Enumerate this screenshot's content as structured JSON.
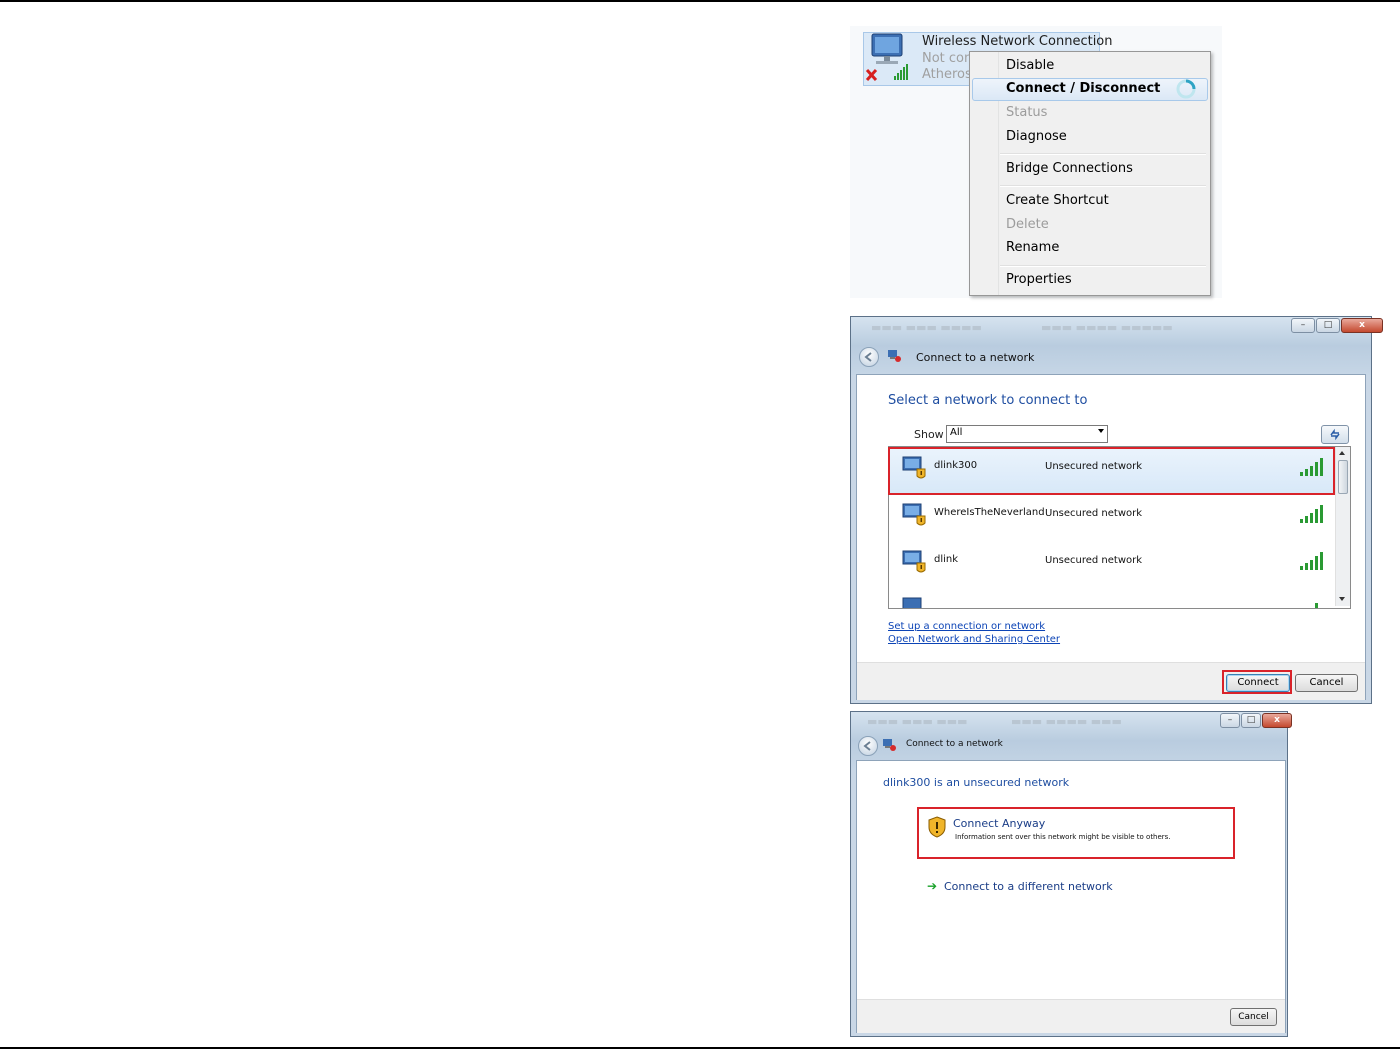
{
  "connection": {
    "name": "Wireless Network Connection",
    "status": "Not con",
    "adapter": "Atheros"
  },
  "context_menu": {
    "items": [
      {
        "label": "Disable",
        "enabled": true,
        "bold": false
      },
      {
        "label": "Connect / Disconnect",
        "enabled": true,
        "bold": true,
        "highlighted": true
      },
      {
        "label": "Status",
        "enabled": false,
        "bold": false
      },
      {
        "label": "Diagnose",
        "enabled": true,
        "bold": false
      },
      {
        "label": "Bridge Connections",
        "enabled": true,
        "bold": false
      },
      {
        "label": "Create Shortcut",
        "enabled": true,
        "bold": false
      },
      {
        "label": "Delete",
        "enabled": false,
        "bold": false
      },
      {
        "label": "Rename",
        "enabled": true,
        "bold": false
      },
      {
        "label": "Properties",
        "enabled": true,
        "bold": false
      }
    ]
  },
  "connect_window": {
    "title": "Connect to a network",
    "heading": "Select a network to connect to",
    "show_label": "Show",
    "show_value": "All",
    "networks": [
      {
        "ssid": "dlink300",
        "security": "Unsecured network",
        "selected": true
      },
      {
        "ssid": "WhereIsTheNeverland",
        "security": "Unsecured network",
        "selected": false
      },
      {
        "ssid": "dlink",
        "security": "Unsecured network",
        "selected": false
      }
    ],
    "links": [
      "Set up a connection or network",
      "Open Network and Sharing Center"
    ],
    "connect_button": "Connect",
    "cancel_button": "Cancel",
    "highlight_color": "#d9232a"
  },
  "unsecured_window": {
    "title": "Connect to a network",
    "heading": "dlink300 is an unsecured network",
    "option_title": "Connect Anyway",
    "option_subtitle": "Information sent over this network might be visible to others.",
    "other_option": "Connect to a different network",
    "cancel_button": "Cancel"
  }
}
